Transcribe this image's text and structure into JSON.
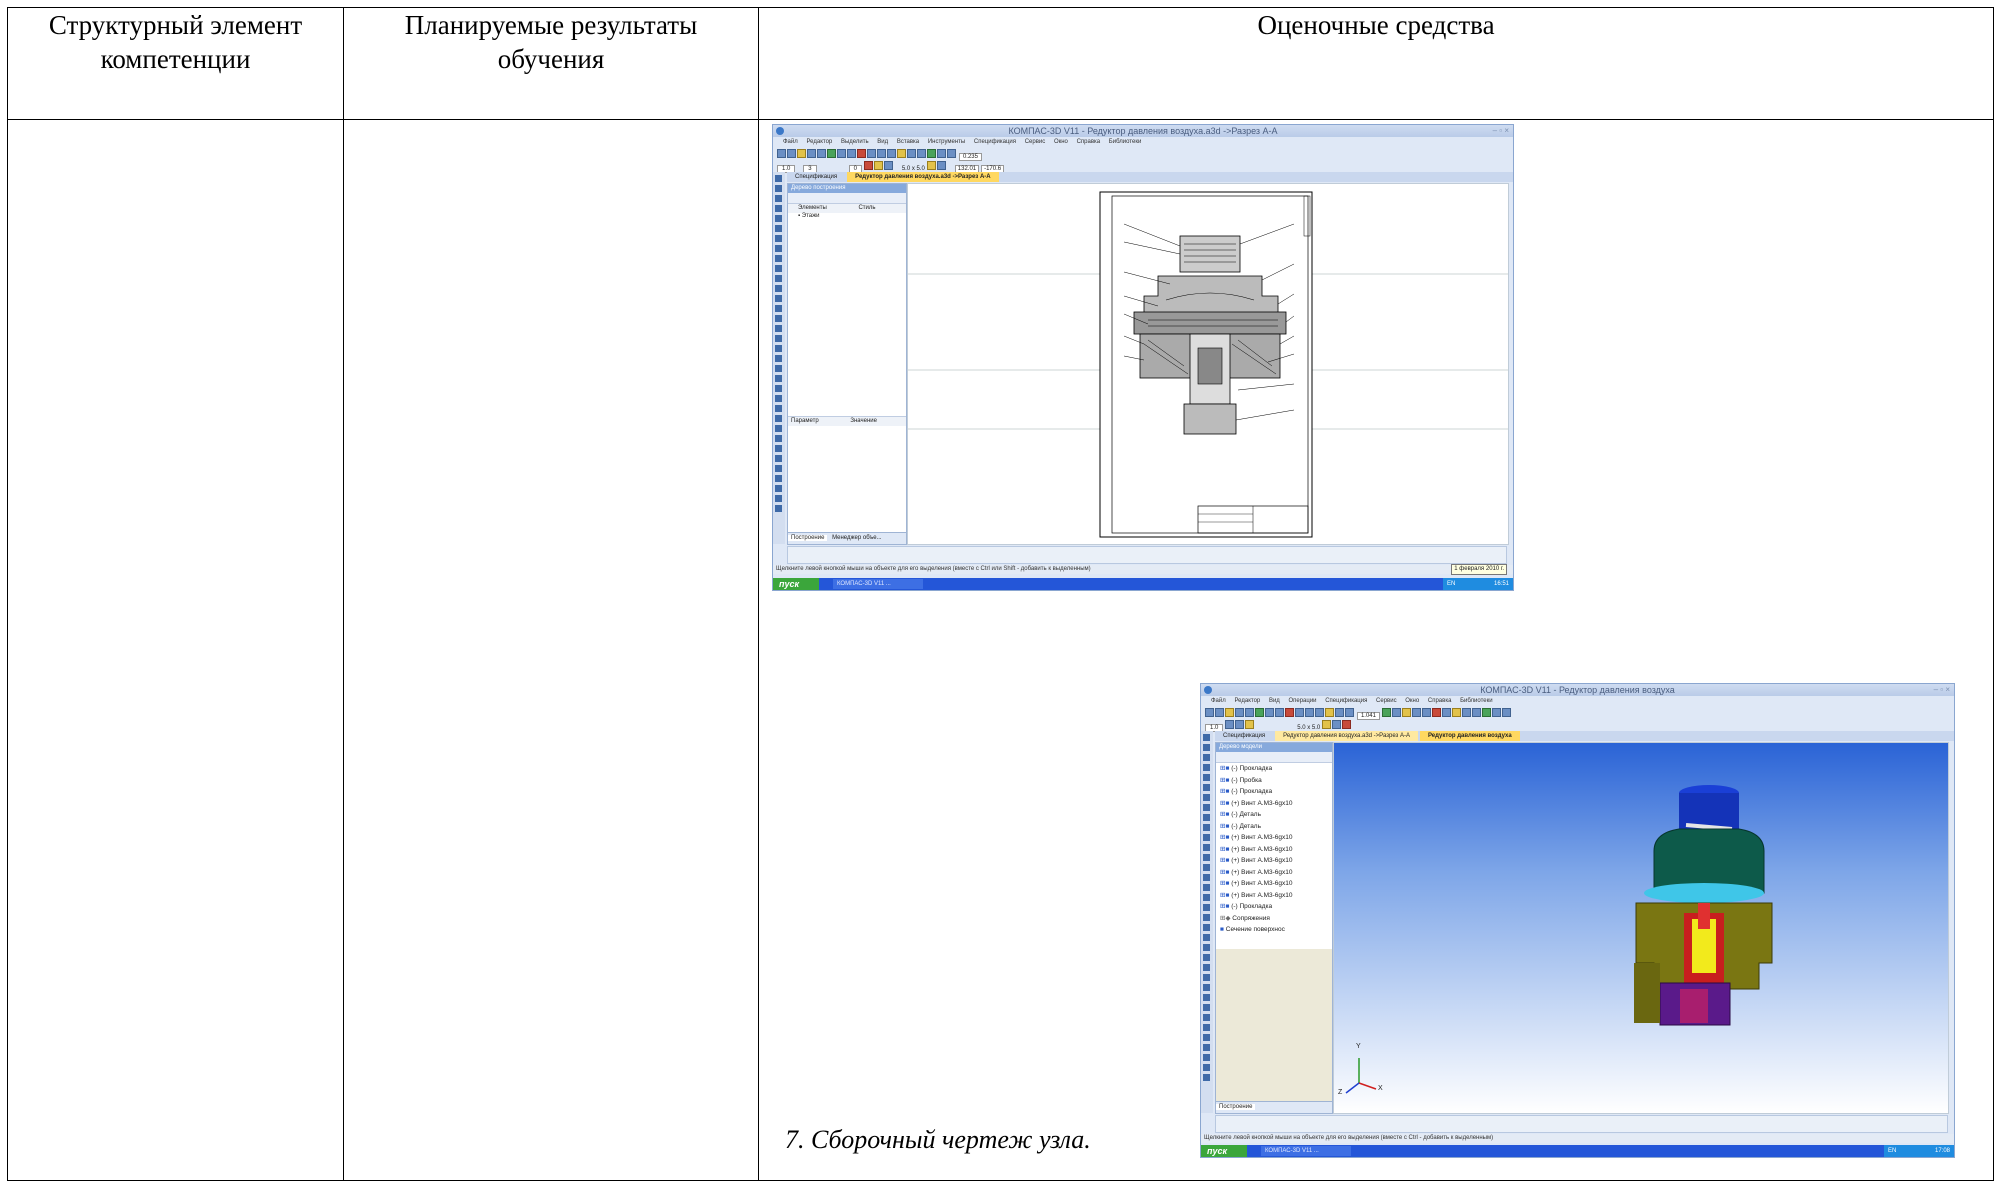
{
  "table": {
    "col1_header": "Структурный элемент компетенции",
    "col2_header": "Планируемые результаты обучения",
    "col3_header": "Оценочные средства"
  },
  "screenshot1": {
    "title": "КОМПАС-3D V11 - Редуктор давления воздуха.a3d ->Разрез А-А",
    "menu": [
      "Файл",
      "Редактор",
      "Выделить",
      "Вид",
      "Вставка",
      "Инструменты",
      "Спецификация",
      "Сервис",
      "Окно",
      "Справка",
      "Библиотеки"
    ],
    "toolbar_scale": "0.235",
    "toolbar_fields": [
      "1.0",
      "3",
      "0",
      "5.0 x 5.0",
      "132.01",
      "-170.6"
    ],
    "tabs": [
      "Спецификация",
      "Редуктор давления воздуха.a3d ->Разрез А-А"
    ],
    "tree_title": "Дерево построения",
    "tree_columns": [
      "Элементы",
      "Стиль"
    ],
    "tree_items": [
      "Этажи"
    ],
    "param_columns": [
      "Параметр",
      "Значение"
    ],
    "bottom_tabs": [
      "Построение",
      "Менеджер объе..."
    ],
    "status": "Щелкните левой кнопкой мыши на объекте для его выделения (вместе с Ctrl или Shift - добавить к выделенным)",
    "date_tooltip": "1 февраля 2010 г.",
    "start": "пуск",
    "taskbar_item": "КОМПАС-3D V11 ...",
    "lang": "EN",
    "clock": "16:51"
  },
  "screenshot2": {
    "title": "КОМПАС-3D V11 - Редуктор давления воздуха",
    "menu": [
      "Файл",
      "Редактор",
      "Вид",
      "Операции",
      "Спецификация",
      "Сервис",
      "Окно",
      "Справка",
      "Библиотеки"
    ],
    "toolbar_scale": "1.041",
    "toolbar_fields": [
      "1.0",
      "5.0 x 5.0"
    ],
    "tabs": [
      "Спецификация",
      "Редуктор давления воздуха.a3d ->Разрез А-А",
      "Редуктор давления воздуха"
    ],
    "tree_title": "Дерево модели",
    "tree_items": [
      "(-) Прокладка",
      "(-) Пробка",
      "(-) Прокладка",
      "(+) Винт А.М3-6gx10",
      "(-) Деталь",
      "(-) Деталь",
      "(+) Винт А.М3-6gx10",
      "(+) Винт А.М3-6gx10",
      "(+) Винт А.М3-6gx10",
      "(+) Винт А.М3-6gx10",
      "(+) Винт А.М3-6gx10",
      "(+) Винт А.М3-6gx10",
      "(-) Прокладка",
      "Сопряжения",
      "Сечение поверхнос"
    ],
    "bottom_tabs": [
      "Построение"
    ],
    "status": "Щелкните левой кнопкой мыши на объекте для его выделения (вместе с Ctrl - добавить к выделенным)",
    "start": "пуск",
    "taskbar_item": "КОМПАС-3D V11 ...",
    "lang": "EN",
    "clock": "17:08",
    "axis_labels": [
      "Y",
      "X",
      "Z"
    ]
  },
  "caption": "7. Сборочный чертеж узла.",
  "colors": {
    "title_gradient": "#b9cbe8",
    "tab_active": "#ffd860",
    "taskbar": "#2456d8",
    "start_button": "#3ba63b",
    "viewport_top": "#2a63d6",
    "viewport_bottom": "#ffffff"
  }
}
